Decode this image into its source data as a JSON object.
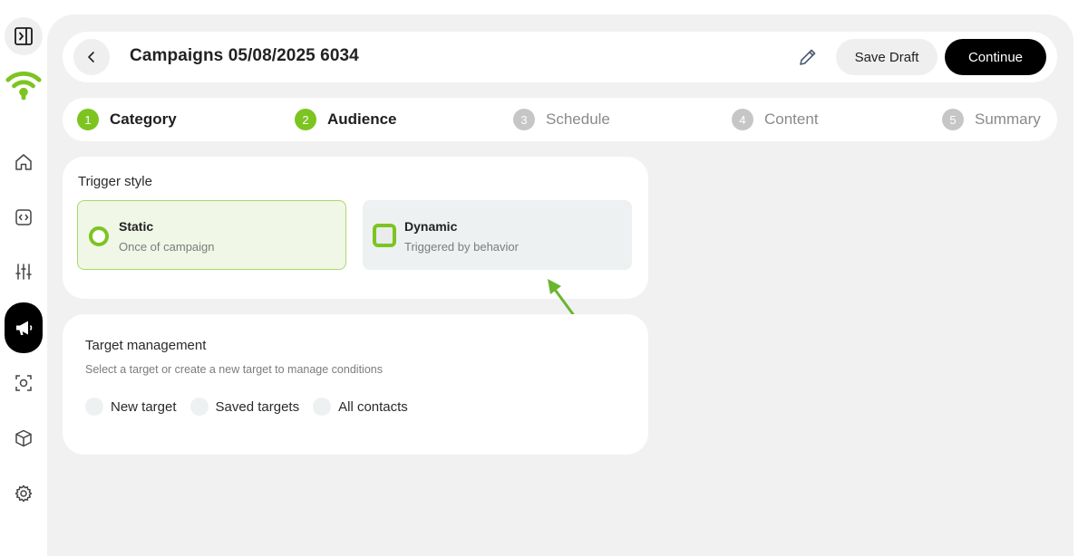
{
  "header": {
    "title": "Campaigns 05/08/2025 6034",
    "save_draft_label": "Save Draft",
    "continue_label": "Continue"
  },
  "steps": [
    {
      "num": "1",
      "label": "Category",
      "state": "done"
    },
    {
      "num": "2",
      "label": "Audience",
      "state": "done"
    },
    {
      "num": "3",
      "label": "Schedule",
      "state": "todo"
    },
    {
      "num": "4",
      "label": "Content",
      "state": "todo"
    },
    {
      "num": "5",
      "label": "Summary",
      "state": "todo"
    }
  ],
  "trigger": {
    "title": "Trigger style",
    "options": [
      {
        "name": "Static",
        "desc": "Once of campaign"
      },
      {
        "name": "Dynamic",
        "desc": "Triggered by behavior"
      }
    ]
  },
  "target": {
    "title": "Target management",
    "subtitle": "Select a target or create a new target to manage conditions",
    "options": [
      "New target",
      "Saved targets",
      "All contacts"
    ]
  },
  "sidebar": {
    "icons": [
      "panel-toggle-icon",
      "brand-logo",
      "home-icon",
      "code-icon",
      "sliders-icon",
      "megaphone-icon",
      "scan-icon",
      "box-icon",
      "gear-icon"
    ],
    "active": "megaphone-icon"
  },
  "colors": {
    "accent": "#7dc421",
    "primary_button": "#000000",
    "background": "#f1f1f1"
  }
}
